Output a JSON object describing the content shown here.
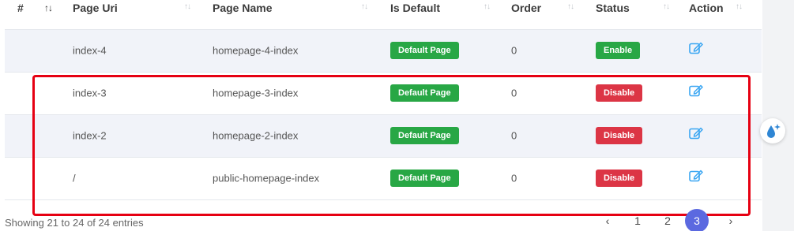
{
  "table": {
    "columns": [
      {
        "key": "hash",
        "label": "#"
      },
      {
        "key": "sort",
        "label": ""
      },
      {
        "key": "page_uri",
        "label": "Page Uri"
      },
      {
        "key": "page_name",
        "label": "Page Name"
      },
      {
        "key": "is_default",
        "label": "Is Default"
      },
      {
        "key": "order",
        "label": "Order"
      },
      {
        "key": "status",
        "label": "Status"
      },
      {
        "key": "action",
        "label": "Action"
      }
    ],
    "rows": [
      {
        "page_uri": "index-4",
        "page_name": "homepage-4-index",
        "is_default": "Default Page",
        "order": "0",
        "status": "Enable",
        "status_type": "success"
      },
      {
        "page_uri": "index-3",
        "page_name": "homepage-3-index",
        "is_default": "Default Page",
        "order": "0",
        "status": "Disable",
        "status_type": "danger"
      },
      {
        "page_uri": "index-2",
        "page_name": "homepage-2-index",
        "is_default": "Default Page",
        "order": "0",
        "status": "Disable",
        "status_type": "danger"
      },
      {
        "page_uri": "/",
        "page_name": "public-homepage-index",
        "is_default": "Default Page",
        "order": "0",
        "status": "Disable",
        "status_type": "danger"
      }
    ]
  },
  "footer": {
    "info": "Showing 21 to 24 of 24 entries"
  },
  "pagination": {
    "prev": "‹",
    "pages": [
      "1",
      "2",
      "3"
    ],
    "active": "3",
    "next": "›"
  },
  "colors": {
    "success": "#28a745",
    "danger": "#dc3545",
    "highlight": "#e60012",
    "active_page": "#5b69e0",
    "edit_icon": "#3aa6f2"
  },
  "icons": {
    "edit": "edit-icon",
    "widget": "water-drop-sparkle-icon"
  }
}
